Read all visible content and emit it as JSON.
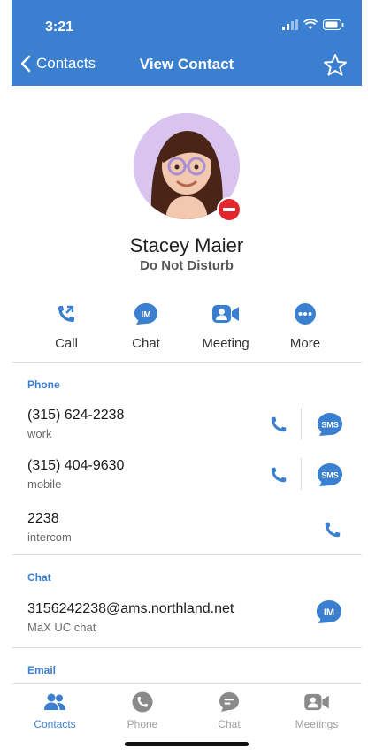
{
  "status_bar": {
    "time": "3:21"
  },
  "nav": {
    "back_label": "Contacts",
    "title": "View Contact"
  },
  "contact": {
    "name": "Stacey Maier",
    "presence": "Do Not Disturb"
  },
  "actions": [
    {
      "label": "Call",
      "icon": "call-icon"
    },
    {
      "label": "Chat",
      "icon": "im-icon"
    },
    {
      "label": "Meeting",
      "icon": "meeting-icon"
    },
    {
      "label": "More",
      "icon": "more-icon"
    }
  ],
  "sections": {
    "phone": {
      "label": "Phone",
      "entries": [
        {
          "number": "(315) 624-2238",
          "type": "work"
        },
        {
          "number": "(315) 404-9630",
          "type": "mobile"
        },
        {
          "number": "2238",
          "type": "intercom"
        }
      ],
      "sms_label": "SMS"
    },
    "chat": {
      "label": "Chat",
      "address": "3156242238@ams.northland.net",
      "type": "MaX UC chat",
      "im_label": "IM"
    },
    "email": {
      "label": "Email"
    }
  },
  "tabs": [
    {
      "label": "Contacts",
      "icon": "contacts-icon",
      "active": true
    },
    {
      "label": "Phone",
      "icon": "phone-icon",
      "active": false
    },
    {
      "label": "Chat",
      "icon": "chat-icon",
      "active": false
    },
    {
      "label": "Meetings",
      "icon": "meetings-icon",
      "active": false
    }
  ],
  "colors": {
    "accent": "#3a7fd0",
    "dnd": "#e3262d",
    "avatar_bg": "#d9c4ef"
  }
}
